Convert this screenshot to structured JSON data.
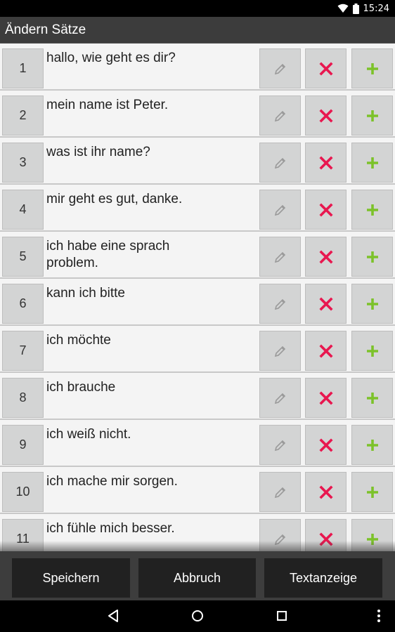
{
  "status_bar": {
    "time": "15:24",
    "icons": [
      "wifi-icon",
      "battery-icon"
    ]
  },
  "title": "Ändern Sätze",
  "rows": [
    {
      "num": "1",
      "text": "hallo, wie geht es dir?"
    },
    {
      "num": "2",
      "text": "mein name ist Peter."
    },
    {
      "num": "3",
      "text": "was ist ihr name?"
    },
    {
      "num": "4",
      "text": "mir geht es gut, danke."
    },
    {
      "num": "5",
      "text": "ich habe eine sprach\nproblem."
    },
    {
      "num": "6",
      "text": "kann ich bitte"
    },
    {
      "num": "7",
      "text": "ich möchte"
    },
    {
      "num": "8",
      "text": "ich brauche"
    },
    {
      "num": "9",
      "text": "ich weiß nicht."
    },
    {
      "num": "10",
      "text": "ich mache mir sorgen."
    },
    {
      "num": "11",
      "text": "ich fühle mich besser."
    }
  ],
  "row_actions": [
    "pencil-icon",
    "delete-x-icon",
    "plus-icon"
  ],
  "colors": {
    "delete": "#e8174f",
    "add": "#7cc22a",
    "edit": "#9a9a9a"
  },
  "buttons": {
    "save": "Speichern",
    "cancel": "Abbruch",
    "text_display": "Textanzeige"
  },
  "nav_bar": [
    "back-icon",
    "home-icon",
    "recents-icon",
    "overflow-menu-icon"
  ]
}
